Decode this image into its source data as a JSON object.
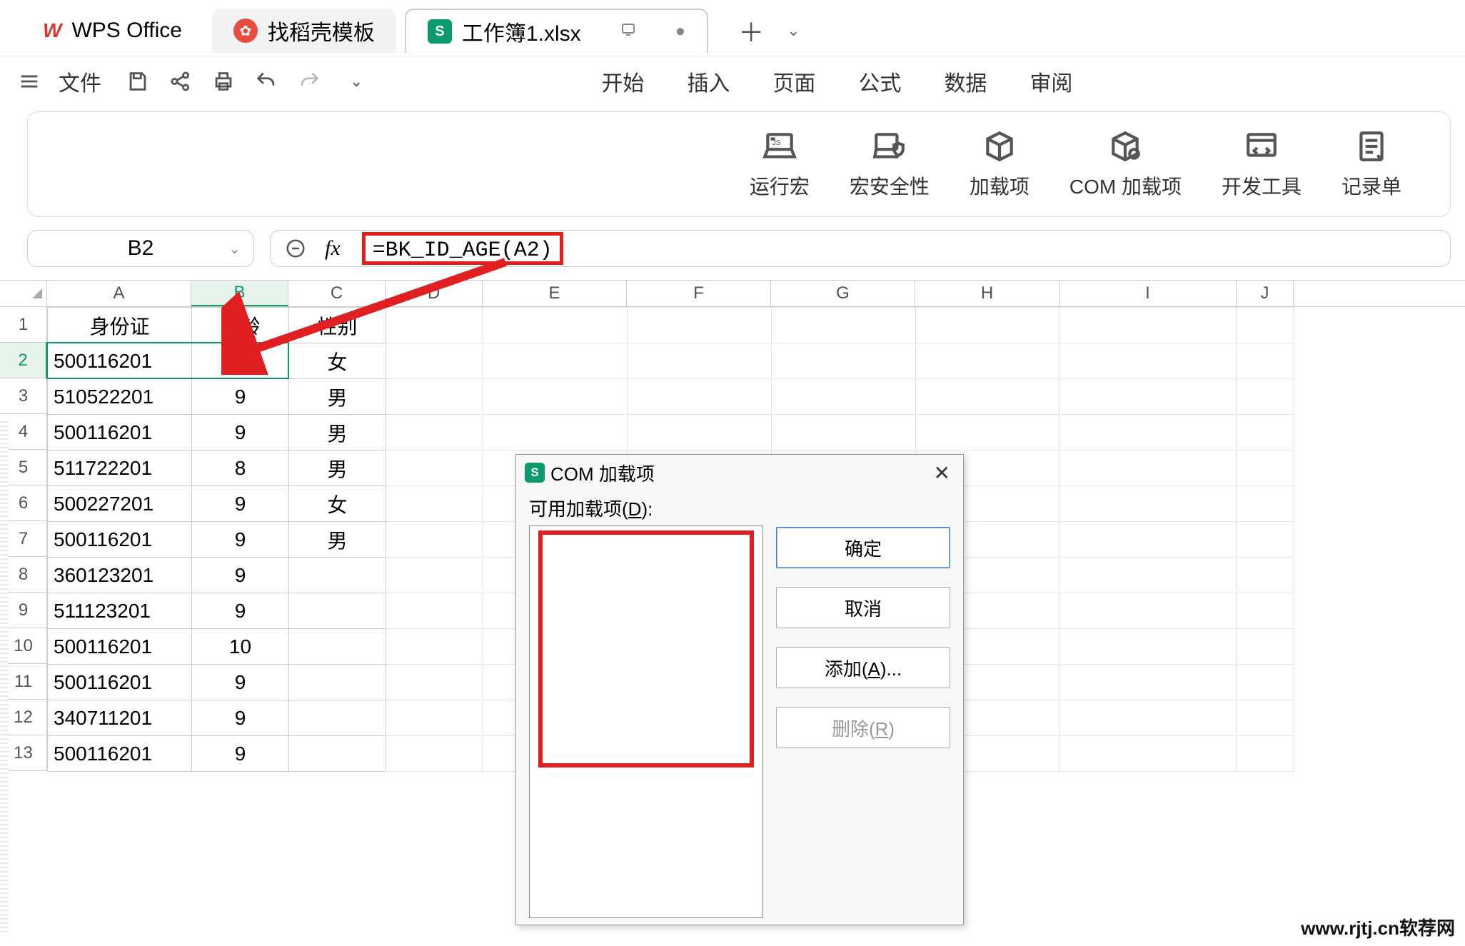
{
  "tabs": {
    "wps_label": "WPS Office",
    "template_label": "找稻壳模板",
    "workbook_label": "工作簿1.xlsx"
  },
  "menu": {
    "file": "文件",
    "tabs": [
      "开始",
      "插入",
      "页面",
      "公式",
      "数据",
      "审阅"
    ]
  },
  "ribbon": {
    "items": [
      {
        "label": "运行宏"
      },
      {
        "label": "宏安全性"
      },
      {
        "label": "加载项"
      },
      {
        "label": "COM 加载项"
      },
      {
        "label": "开发工具"
      },
      {
        "label": "记录单"
      }
    ]
  },
  "formula": {
    "cell_ref": "B2",
    "fx": "fx",
    "content": "=BK_ID_AGE(A2)"
  },
  "columns": [
    "A",
    "B",
    "C",
    "D",
    "E",
    "F",
    "G",
    "H",
    "I",
    "J"
  ],
  "rows": [
    "1",
    "2",
    "3",
    "4",
    "5",
    "6",
    "7",
    "8",
    "9",
    "10",
    "11",
    "12",
    "13"
  ],
  "headers_row": {
    "A": "身份证",
    "B": "年龄",
    "C": "性别"
  },
  "data_rows": [
    {
      "A": "500116201",
      "B": "9",
      "C": "女"
    },
    {
      "A": "510522201",
      "B": "9",
      "C": "男"
    },
    {
      "A": "500116201",
      "B": "9",
      "C": "男"
    },
    {
      "A": "511722201",
      "B": "8",
      "C": "男"
    },
    {
      "A": "500227201",
      "B": "9",
      "C": "女"
    },
    {
      "A": "500116201",
      "B": "9",
      "C": "男"
    },
    {
      "A": "360123201",
      "B": "9",
      "C": ""
    },
    {
      "A": "511123201",
      "B": "9",
      "C": ""
    },
    {
      "A": "500116201",
      "B": "10",
      "C": ""
    },
    {
      "A": "500116201",
      "B": "9",
      "C": ""
    },
    {
      "A": "340711201",
      "B": "9",
      "C": ""
    },
    {
      "A": "500116201",
      "B": "9",
      "C": ""
    }
  ],
  "dialog": {
    "title": "COM 加载项",
    "available_label_pre": "可用加载项(",
    "available_label_u": "D",
    "available_label_post": "):",
    "ok": "确定",
    "cancel": "取消",
    "add_pre": "添加(",
    "add_u": "A",
    "add_post": ")...",
    "remove_pre": "删除(",
    "remove_u": "R",
    "remove_post": ")"
  },
  "watermark": "www.rjtj.cn软荐网"
}
